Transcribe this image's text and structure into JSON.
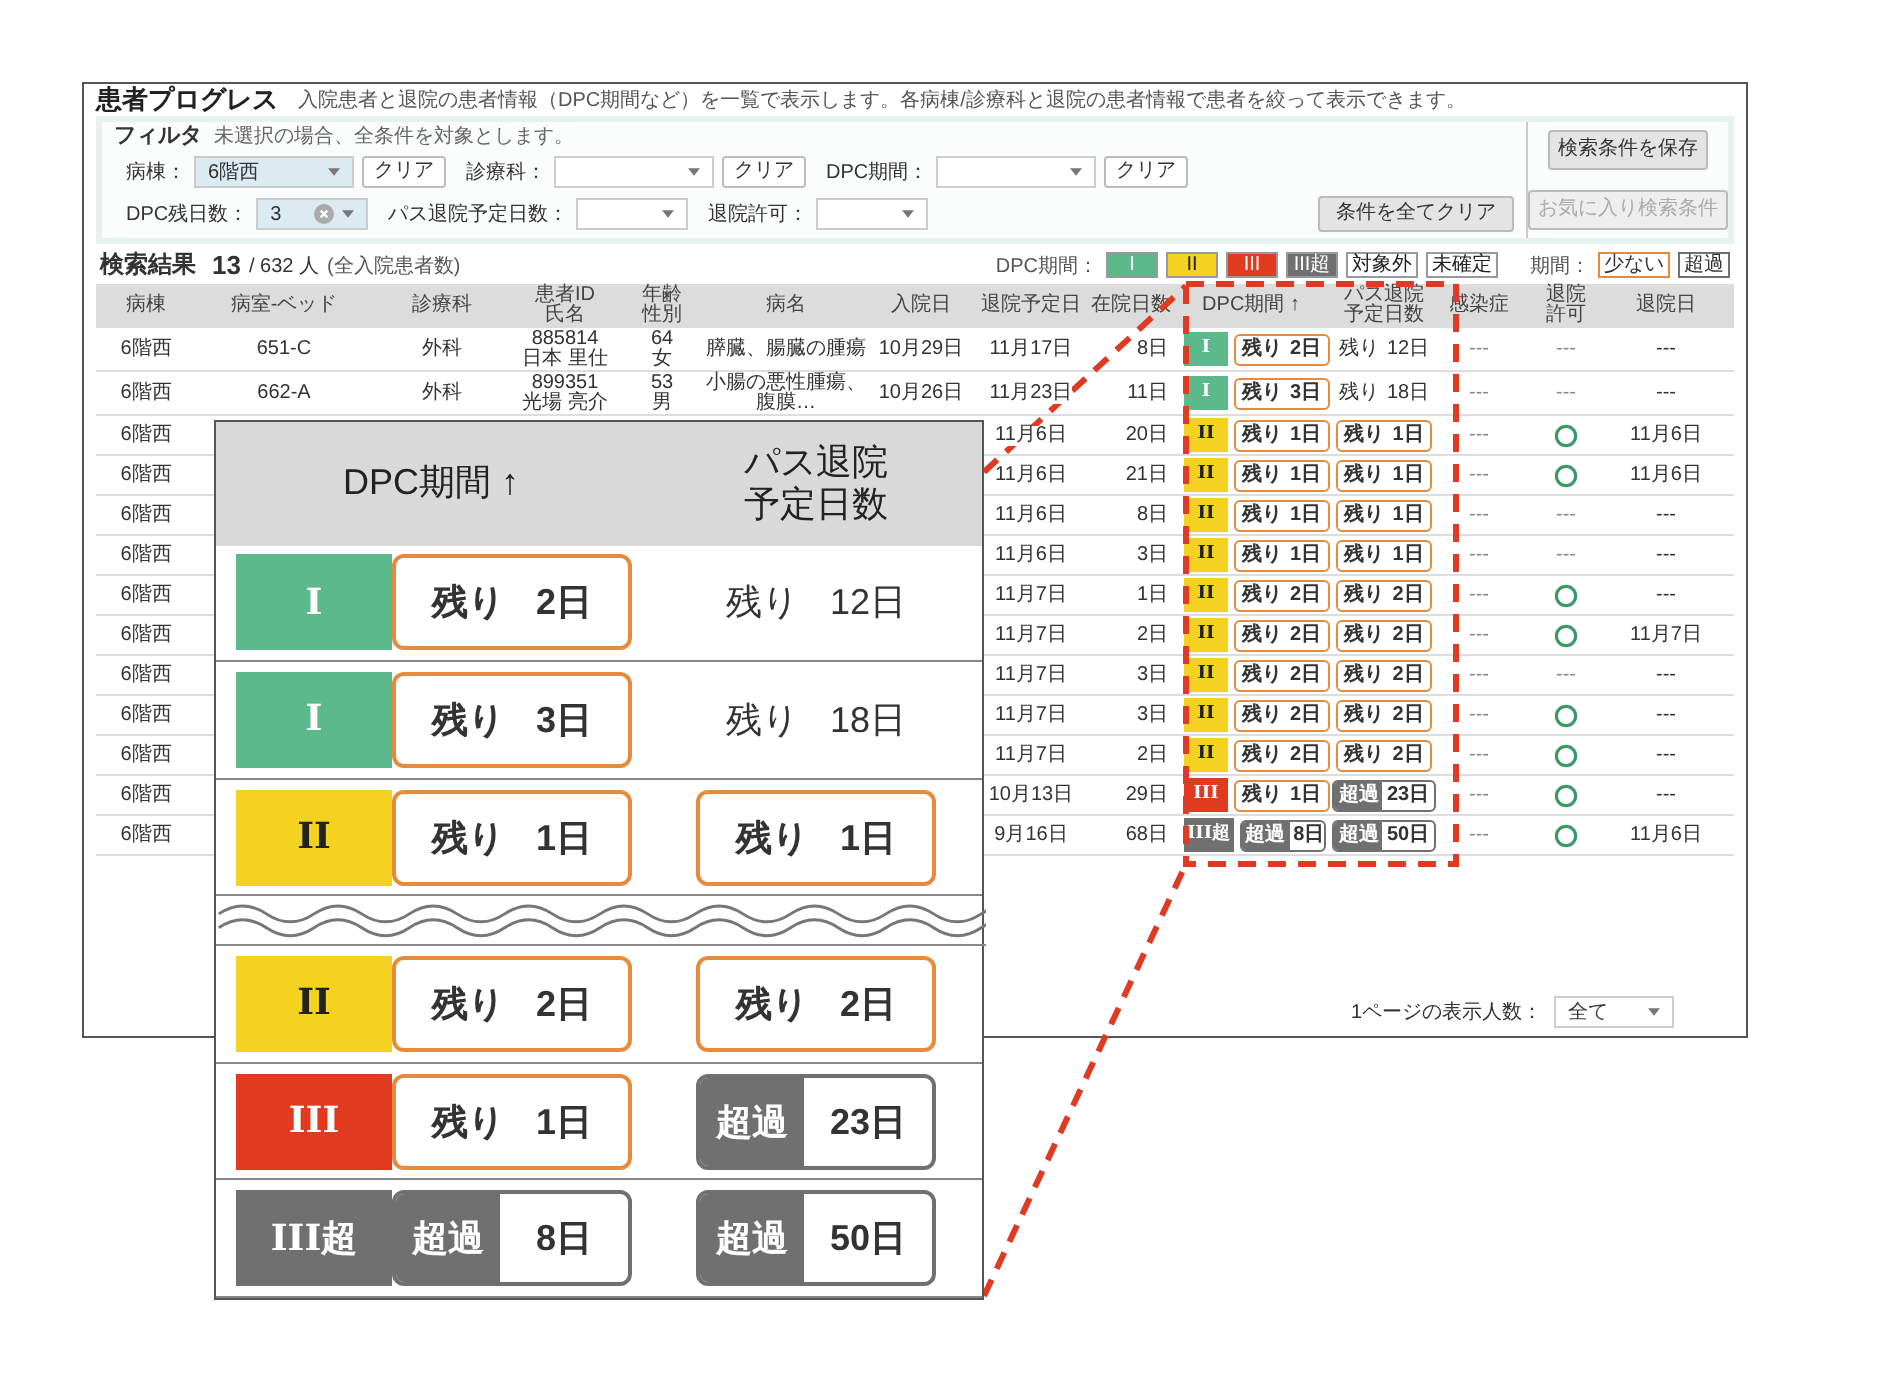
{
  "header": {
    "title": "患者プログレス",
    "description": "入院患者と退院の患者情報（DPC期間など）を一覧で表示します。各病棟/診療科と退院の患者情報で患者を絞って表示できます。"
  },
  "filter": {
    "title": "フィルタ",
    "note": "未選択の場合、全条件を対象とします。",
    "field_rows": [
      [
        {
          "label": "病棟：",
          "value": "6階西",
          "clear_button": "クリア",
          "has_clear_icon": false
        },
        {
          "label": "診療科：",
          "clear_button": "クリア",
          "has_clear_icon": false
        },
        {
          "label": "DPC期間：",
          "clear_button": "クリア",
          "has_clear_icon": false
        }
      ],
      [
        {
          "label": "DPC残日数：",
          "value": "3",
          "has_clear_icon": true
        },
        {
          "label": "パス退院予定日数：",
          "has_clear_icon": false
        },
        {
          "label": "退院許可：",
          "has_clear_icon": false
        }
      ]
    ],
    "clear_all_button": "条件を全てクリア",
    "save_button": "検索条件を保存",
    "favorites_button": {
      "label": "お気に入り検索条件",
      "disabled": true
    }
  },
  "results": {
    "title": "検索結果",
    "count": "13",
    "total": "/ 632 人",
    "total_note": "(全入院患者数)",
    "legend_label": "DPC期間：",
    "legend": [
      {
        "label": "I",
        "color": "#5bb98c"
      },
      {
        "label": "II",
        "color": "#f4d21f"
      },
      {
        "label": "III",
        "color": "#e23a1e"
      },
      {
        "label": "III超",
        "color": "#707070"
      },
      {
        "label": "対象外",
        "color": "#ffffff"
      },
      {
        "label": "未確定",
        "color": "#ffffff"
      }
    ],
    "period_label": "期間：",
    "period_legend": [
      {
        "label": "少ない",
        "color": "#e68a3c"
      },
      {
        "label": "超過",
        "color": "#707070"
      }
    ]
  },
  "table": {
    "columns": [
      "病棟",
      "病室-ベッド",
      "診療科",
      "患者ID\n氏名",
      "年齢性別",
      "病名",
      "入院日",
      "退院予定日",
      "在院日数",
      "DPC期間 ↑",
      "パス退院予定日数",
      "感染症",
      "退院許可",
      "退院日"
    ],
    "rows": [
      {
        "ward": "6階西",
        "room": "651-C",
        "dept": "外科",
        "patient_id": "885814",
        "patient_name": "日本 里仕",
        "age": "64",
        "sex": "女",
        "disease": "膵臓、腸臓の腫瘍",
        "admitted": "10月29日",
        "planned_discharge": "11月17日",
        "days": "8日",
        "dpc": {
          "label": "I",
          "color": "#5bb98c"
        },
        "dpc_remaining": {
          "kind": "remaining",
          "label": "残り",
          "days": "2日"
        },
        "path": {
          "kind": "plain",
          "label": "残り",
          "days": "12日"
        },
        "infection": "---",
        "permit": {
          "kind": "text",
          "text": "---"
        },
        "discharge_date": "---"
      },
      {
        "ward": "6階西",
        "room": "662-A",
        "dept": "外科",
        "patient_id": "899351",
        "patient_name": "光場 亮介",
        "age": "53",
        "sex": "男",
        "disease": "小腸の悪性腫瘍、腹膜…",
        "admitted": "10月26日",
        "planned_discharge": "11月23日",
        "days": "11日",
        "dpc": {
          "label": "I",
          "color": "#5bb98c"
        },
        "dpc_remaining": {
          "kind": "remaining",
          "label": "残り",
          "days": "3日"
        },
        "path": {
          "kind": "plain",
          "label": "残り",
          "days": "18日"
        },
        "infection": "---",
        "permit": {
          "kind": "text",
          "text": "---"
        },
        "discharge_date": "---"
      },
      {
        "ward": "6階西",
        "planned_discharge": "11月6日",
        "days": "20日",
        "dpc": {
          "label": "II",
          "color": "#f4d21f"
        },
        "dpc_remaining": {
          "kind": "remaining",
          "label": "残り",
          "days": "1日"
        },
        "path": {
          "kind": "remaining",
          "label": "残り",
          "days": "1日"
        },
        "infection": "---",
        "permit": {
          "kind": "ok"
        },
        "discharge_date": "11月6日"
      },
      {
        "ward": "6階西",
        "planned_discharge": "11月6日",
        "days": "21日",
        "dpc": {
          "label": "II",
          "color": "#f4d21f"
        },
        "dpc_remaining": {
          "kind": "remaining",
          "label": "残り",
          "days": "1日"
        },
        "path": {
          "kind": "remaining",
          "label": "残り",
          "days": "1日"
        },
        "infection": "---",
        "permit": {
          "kind": "ok"
        },
        "discharge_date": "11月6日"
      },
      {
        "ward": "6階西",
        "planned_discharge": "11月6日",
        "days": "8日",
        "dpc": {
          "label": "II",
          "color": "#f4d21f"
        },
        "dpc_remaining": {
          "kind": "remaining",
          "label": "残り",
          "days": "1日"
        },
        "path": {
          "kind": "remaining",
          "label": "残り",
          "days": "1日"
        },
        "infection": "---",
        "permit": {
          "kind": "text",
          "text": "---"
        },
        "discharge_date": "---"
      },
      {
        "ward": "6階西",
        "planned_discharge": "11月6日",
        "days": "3日",
        "dpc": {
          "label": "II",
          "color": "#f4d21f"
        },
        "dpc_remaining": {
          "kind": "remaining",
          "label": "残り",
          "days": "1日"
        },
        "path": {
          "kind": "remaining",
          "label": "残り",
          "days": "1日"
        },
        "infection": "---",
        "permit": {
          "kind": "text",
          "text": "---"
        },
        "discharge_date": "---"
      },
      {
        "ward": "6階西",
        "planned_discharge": "11月7日",
        "days": "1日",
        "dpc": {
          "label": "II",
          "color": "#f4d21f"
        },
        "dpc_remaining": {
          "kind": "remaining",
          "label": "残り",
          "days": "2日"
        },
        "path": {
          "kind": "remaining",
          "label": "残り",
          "days": "2日"
        },
        "infection": "---",
        "permit": {
          "kind": "ok"
        },
        "discharge_date": "---"
      },
      {
        "ward": "6階西",
        "planned_discharge": "11月7日",
        "days": "2日",
        "dpc": {
          "label": "II",
          "color": "#f4d21f"
        },
        "dpc_remaining": {
          "kind": "remaining",
          "label": "残り",
          "days": "2日"
        },
        "path": {
          "kind": "remaining",
          "label": "残り",
          "days": "2日"
        },
        "infection": "---",
        "permit": {
          "kind": "ok"
        },
        "discharge_date": "11月7日"
      },
      {
        "ward": "6階西",
        "planned_discharge": "11月7日",
        "days": "3日",
        "dpc": {
          "label": "II",
          "color": "#f4d21f"
        },
        "dpc_remaining": {
          "kind": "remaining",
          "label": "残り",
          "days": "2日"
        },
        "path": {
          "kind": "remaining",
          "label": "残り",
          "days": "2日"
        },
        "infection": "---",
        "permit": {
          "kind": "text",
          "text": "---"
        },
        "discharge_date": "---"
      },
      {
        "ward": "6階西",
        "planned_discharge": "11月7日",
        "days": "3日",
        "dpc": {
          "label": "II",
          "color": "#f4d21f"
        },
        "dpc_remaining": {
          "kind": "remaining",
          "label": "残り",
          "days": "2日"
        },
        "path": {
          "kind": "remaining",
          "label": "残り",
          "days": "2日"
        },
        "infection": "---",
        "permit": {
          "kind": "ok"
        },
        "discharge_date": "---"
      },
      {
        "ward": "6階西",
        "planned_discharge": "11月7日",
        "days": "2日",
        "dpc": {
          "label": "II",
          "color": "#f4d21f"
        },
        "dpc_remaining": {
          "kind": "remaining",
          "label": "残り",
          "days": "2日"
        },
        "path": {
          "kind": "remaining",
          "label": "残り",
          "days": "2日"
        },
        "infection": "---",
        "permit": {
          "kind": "ok"
        },
        "discharge_date": "---"
      },
      {
        "ward": "6階西",
        "planned_discharge": "10月13日",
        "days": "29日",
        "dpc": {
          "label": "III",
          "color": "#e23a1e"
        },
        "dpc_remaining": {
          "kind": "remaining",
          "label": "残り",
          "days": "1日"
        },
        "path": {
          "kind": "over",
          "label": "超過",
          "days": "23日"
        },
        "infection": "---",
        "permit": {
          "kind": "ok"
        },
        "discharge_date": "---"
      },
      {
        "ward": "6階西",
        "planned_discharge": "9月16日",
        "days": "68日",
        "dpc": {
          "label": "III超",
          "color": "#707070"
        },
        "dpc_remaining": {
          "kind": "over",
          "label": "超過",
          "days": "8日"
        },
        "path": {
          "kind": "over",
          "label": "超過",
          "days": "50日"
        },
        "infection": "---",
        "permit": {
          "kind": "ok"
        },
        "discharge_date": "11月6日"
      }
    ]
  },
  "footer": {
    "page_size_label": "1ページの表示人数：",
    "page_size": "全て"
  },
  "callout": {
    "columns": [
      "DPC期間 ↑",
      "パス退院予定日数"
    ],
    "rows_top": [
      {
        "dpc": {
          "label": "I",
          "color": "#5bb98c"
        },
        "dpc_remaining": {
          "kind": "remaining",
          "label": "残り",
          "days": "2日"
        },
        "path": {
          "kind": "plain",
          "label": "残り",
          "days": "12日"
        }
      },
      {
        "dpc": {
          "label": "I",
          "color": "#5bb98c"
        },
        "dpc_remaining": {
          "kind": "remaining",
          "label": "残り",
          "days": "3日"
        },
        "path": {
          "kind": "plain",
          "label": "残り",
          "days": "18日"
        }
      },
      {
        "dpc": {
          "label": "II",
          "color": "#f4d21f"
        },
        "dpc_remaining": {
          "kind": "remaining",
          "label": "残り",
          "days": "1日"
        },
        "path": {
          "kind": "remaining",
          "label": "残り",
          "days": "1日"
        }
      }
    ],
    "rows_bottom": [
      {
        "dpc": {
          "label": "II",
          "color": "#f4d21f"
        },
        "dpc_remaining": {
          "kind": "remaining",
          "label": "残り",
          "days": "2日"
        },
        "path": {
          "kind": "remaining",
          "label": "残り",
          "days": "2日"
        }
      },
      {
        "dpc": {
          "label": "III",
          "color": "#e23a1e"
        },
        "dpc_remaining": {
          "kind": "remaining",
          "label": "残り",
          "days": "1日"
        },
        "path": {
          "kind": "over",
          "label": "超過",
          "days": "23日"
        }
      },
      {
        "dpc": {
          "label": "III超",
          "color": "#707070"
        },
        "dpc_remaining": {
          "kind": "over",
          "label": "超過",
          "days": "8日"
        },
        "path": {
          "kind": "over",
          "label": "超過",
          "days": "50日"
        }
      }
    ]
  }
}
